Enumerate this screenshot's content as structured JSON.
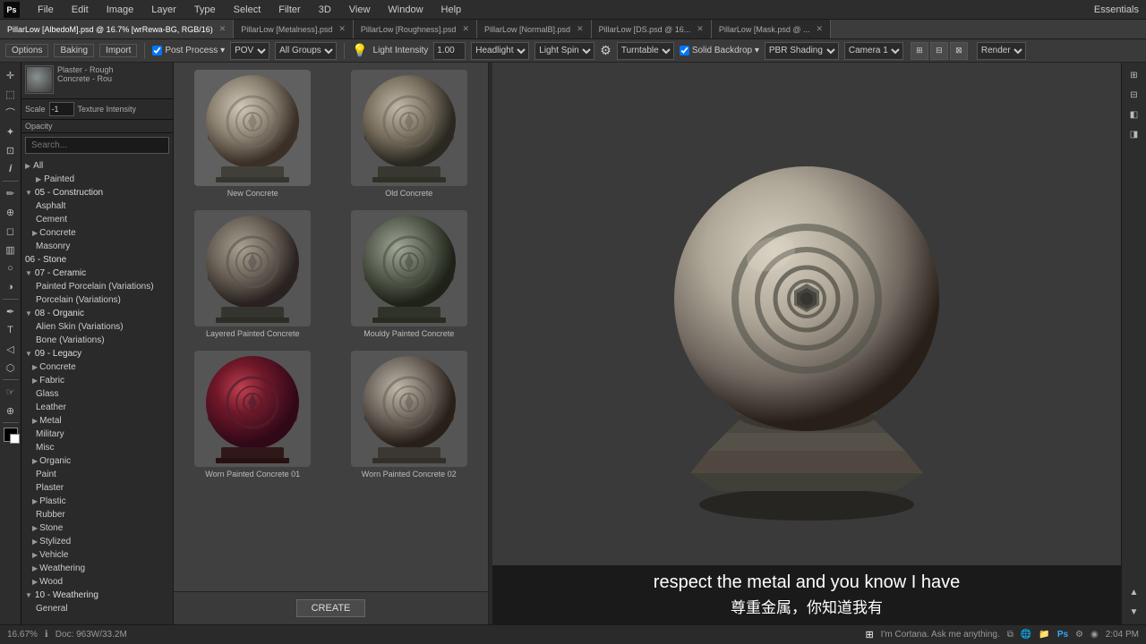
{
  "app": {
    "title": "Photoshop",
    "menu_items": [
      "Ps",
      "File",
      "Edit",
      "Image",
      "Layer",
      "Type",
      "Select",
      "Filter",
      "3D",
      "View",
      "Window",
      "Help"
    ]
  },
  "tabs": [
    {
      "label": "PillarLow [AlbedoM].psd @ 16.7% [wrRewa-BG], RGB/16)",
      "active": true
    },
    {
      "label": "PillarLow [Metalness].psd"
    },
    {
      "label": "PillarLow [Roughness].psd"
    },
    {
      "label": "PillarLow [NormalB].psd"
    },
    {
      "label": "PillarLow [DS.psd @ 16..."
    },
    {
      "label": "PillarLow [Mask.psd @ ..."
    }
  ],
  "title_bar": {
    "text": "PillarLow [AlbedoM].psd @ 16.7% (wrRewa-BG, RGB/16)"
  },
  "toolbar": {
    "options": "Options",
    "baking": "Baking",
    "import": "Import",
    "post_process": "Post Process",
    "pov": "POV",
    "all_groups": "All Groups",
    "light_intensity": "Light Intensity",
    "intensity_val": "1.00",
    "headlight": "Headlight",
    "light_spin": "Light Spin",
    "turntable": "Turntable",
    "solid_backdrop": "Solid Backdrop",
    "pbr_shading": "PBR Shading",
    "camera1": "Camera 1",
    "render": "Render",
    "essentials": "Essentials"
  },
  "sidebar": {
    "search_placeholder": "Search...",
    "tree": [
      {
        "label": "Painted",
        "level": 1,
        "expanded": false
      },
      {
        "label": "05 - Construction",
        "level": 0,
        "expanded": true
      },
      {
        "label": "Asphalt",
        "level": 1
      },
      {
        "label": "Cement",
        "level": 1
      },
      {
        "label": "Concrete",
        "level": 1,
        "has_arrow": true
      },
      {
        "label": "Masonry",
        "level": 1
      },
      {
        "label": "06 - Stone",
        "level": 0
      },
      {
        "label": "07 - Ceramic",
        "level": 0,
        "expanded": true
      },
      {
        "label": "Painted Porcelain (Variations)",
        "level": 1
      },
      {
        "label": "Porcelain (Variations)",
        "level": 1
      },
      {
        "label": "08 - Organic",
        "level": 0,
        "expanded": true
      },
      {
        "label": "Alien Skin (Variations)",
        "level": 1
      },
      {
        "label": "Bone (Variations)",
        "level": 1
      },
      {
        "label": "09 - Legacy",
        "level": 0,
        "expanded": true
      },
      {
        "label": "Concrete",
        "level": 1,
        "has_arrow": true
      },
      {
        "label": "Fabric",
        "level": 1,
        "has_arrow": true
      },
      {
        "label": "Glass",
        "level": 1
      },
      {
        "label": "Leather",
        "level": 1
      },
      {
        "label": "Metal",
        "level": 1,
        "has_arrow": true
      },
      {
        "label": "Military",
        "level": 1
      },
      {
        "label": "Misc",
        "level": 1
      },
      {
        "label": "Organic",
        "level": 1,
        "has_arrow": true
      },
      {
        "label": "Paint",
        "level": 1
      },
      {
        "label": "Plaster",
        "level": 1
      },
      {
        "label": "Plastic",
        "level": 1,
        "has_arrow": true
      },
      {
        "label": "Rubber",
        "level": 1
      },
      {
        "label": "Stone",
        "level": 1,
        "has_arrow": true
      },
      {
        "label": "Stylized",
        "level": 1,
        "has_arrow": true
      },
      {
        "label": "Vehicle",
        "level": 1,
        "has_arrow": true
      },
      {
        "label": "Weathering",
        "level": 1,
        "has_arrow": true
      },
      {
        "label": "Wood",
        "level": 1,
        "has_arrow": true
      },
      {
        "label": "10 - Weathering",
        "level": 0,
        "expanded": true
      },
      {
        "label": "General",
        "level": 1
      }
    ]
  },
  "materials": [
    {
      "name": "New Concrete",
      "style": "sphere-concrete",
      "row": 0,
      "col": 0
    },
    {
      "name": "Old Concrete",
      "style": "sphere-concrete-old",
      "row": 0,
      "col": 1
    },
    {
      "name": "Layered Painted Concrete",
      "style": "sphere-painted-concrete",
      "row": 1,
      "col": 0
    },
    {
      "name": "Mouldy Painted Concrete",
      "style": "sphere-moldy",
      "row": 1,
      "col": 1
    },
    {
      "name": "Worn Painted Concrete 01",
      "style": "sphere-red",
      "row": 2,
      "col": 0
    },
    {
      "name": "Worn Painted Concrete 02",
      "style": "sphere-worn-02",
      "row": 2,
      "col": 1
    }
  ],
  "create_btn": "CREATE",
  "viewport": {
    "toolbar_items": [
      "POV▾",
      "All Groups▾",
      "💡 Light Intensity",
      "1.00",
      "Headlight▾",
      "Light Spin▾",
      "Turntable▾",
      "☑ Solid Backdrop▾",
      "PBR Shading▾",
      "Camera 1▾",
      "Render▾"
    ]
  },
  "subtitle": {
    "en": "respect the metal and you know I have",
    "zh": "尊重金属，你知道我有"
  },
  "bottom_bar": {
    "zoom": "16.67%",
    "doc_size": "Doc: 963W/33.2M",
    "time": "2:04 PM"
  }
}
